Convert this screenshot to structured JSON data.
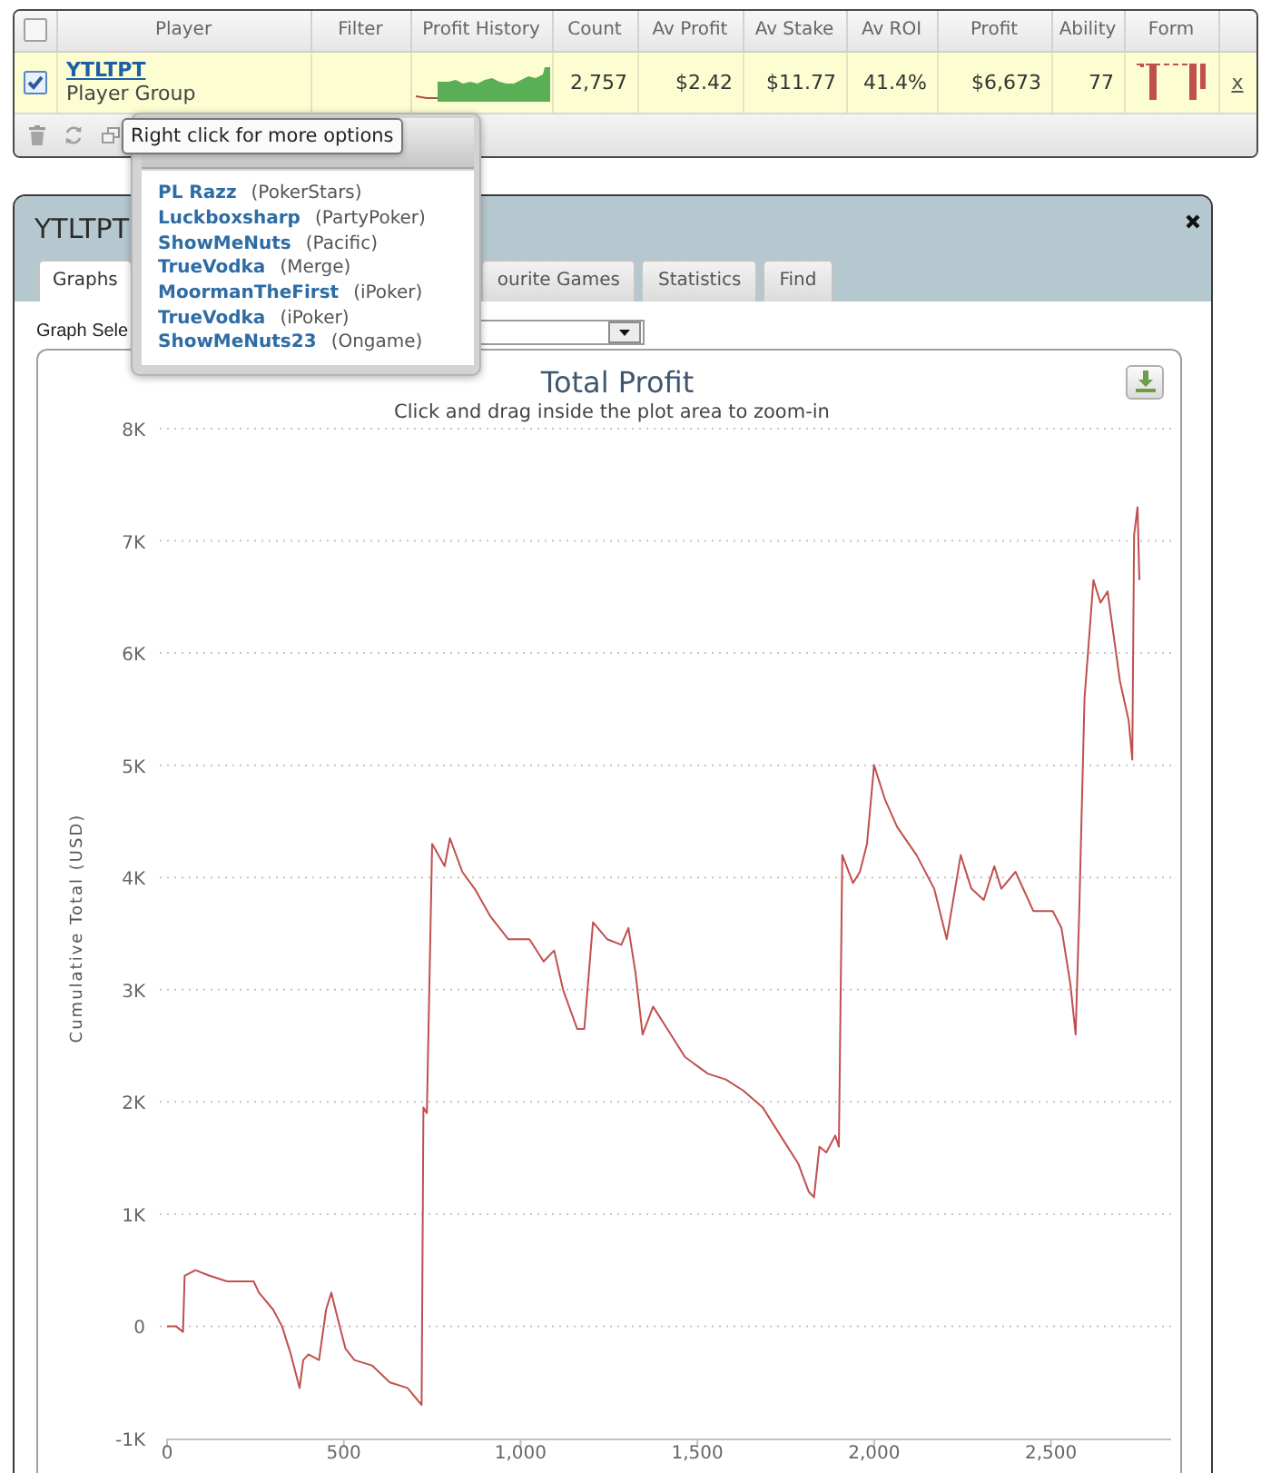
{
  "player_table": {
    "header_checked": false,
    "columns": [
      "Player",
      "Filter",
      "Profit History",
      "Count",
      "Av Profit",
      "Av Stake",
      "Av ROI",
      "Profit",
      "Ability",
      "Form"
    ],
    "rows": [
      {
        "checked": true,
        "player": "YTLTPT",
        "group": "Player Group",
        "count": "2,757",
        "av_profit": "$2.42",
        "av_stake": "$11.77",
        "av_roi": "41.4%",
        "profit": "$6,673",
        "ability": "77",
        "remove": "x"
      }
    ]
  },
  "tooltip": {
    "text": "Right click for more options"
  },
  "accounts_popup": {
    "items": [
      {
        "name": "PL Razz",
        "network": "(PokerStars)"
      },
      {
        "name": "Luckboxsharp",
        "network": "(PartyPoker)"
      },
      {
        "name": "ShowMeNuts",
        "network": "(Pacific)"
      },
      {
        "name": "TrueVodka",
        "network": "(Merge)"
      },
      {
        "name": "MoormanTheFirst",
        "network": "(iPoker)"
      },
      {
        "name": "TrueVodka",
        "network": "(iPoker)"
      },
      {
        "name": "ShowMeNuts23",
        "network": "(Ongame)"
      }
    ]
  },
  "window": {
    "title": "YTLTPT",
    "tabs": [
      {
        "label": "Graphs",
        "selected": true
      },
      {
        "label": "ourite Games",
        "selected": false
      },
      {
        "label": "Statistics",
        "selected": false
      },
      {
        "label": "Find",
        "selected": false
      }
    ],
    "graph_select": {
      "label": "Graph Sele"
    },
    "chart": {
      "subtitle": "Click and drag inside the plot area to zoom-in",
      "chart_data": {
        "type": "line",
        "title": "Total Profit",
        "ylabel": "Cumulative Total (USD)",
        "grid": true,
        "x": [
          0,
          25,
          45,
          50,
          80,
          120,
          170,
          245,
          260,
          300,
          325,
          350,
          375,
          385,
          400,
          430,
          450,
          465,
          480,
          505,
          530,
          580,
          630,
          680,
          720,
          725,
          735,
          750,
          785,
          800,
          835,
          870,
          915,
          965,
          1025,
          1065,
          1095,
          1120,
          1160,
          1180,
          1205,
          1245,
          1285,
          1305,
          1325,
          1345,
          1375,
          1415,
          1465,
          1530,
          1580,
          1630,
          1685,
          1735,
          1785,
          1815,
          1830,
          1845,
          1865,
          1890,
          1900,
          1910,
          1940,
          1960,
          1980,
          2000,
          2030,
          2065,
          2120,
          2170,
          2205,
          2245,
          2275,
          2310,
          2340,
          2360,
          2400,
          2450,
          2505,
          2530,
          2555,
          2570,
          2580,
          2595,
          2605,
          2620,
          2640,
          2660,
          2695,
          2720,
          2730,
          2735,
          2745,
          2750
        ],
        "series": [
          {
            "color": "#c0504d",
            "values": [
              0,
              0,
              -50,
              450,
              500,
              450,
              400,
              400,
              300,
              150,
              0,
              -250,
              -550,
              -300,
              -250,
              -300,
              150,
              300,
              100,
              -200,
              -300,
              -350,
              -500,
              -550,
              -700,
              1950,
              1900,
              4300,
              4100,
              4350,
              4050,
              3900,
              3650,
              3450,
              3450,
              3250,
              3350,
              3000,
              2650,
              2650,
              3600,
              3450,
              3400,
              3550,
              3150,
              2600,
              2850,
              2650,
              2400,
              2250,
              2200,
              2100,
              1950,
              1700,
              1450,
              1200,
              1150,
              1600,
              1550,
              1700,
              1600,
              4200,
              3950,
              4050,
              4300,
              5000,
              4700,
              4450,
              4200,
              3900,
              3450,
              4200,
              3900,
              3800,
              4100,
              3900,
              4050,
              3700,
              3700,
              3550,
              3050,
              2600,
              3700,
              5600,
              6000,
              6650,
              6450,
              6550,
              5750,
              5400,
              5050,
              7050,
              7300,
              6650
            ]
          }
        ],
        "xlim": [
          0,
          2840
        ],
        "ylim": [
          -1000,
          8000
        ],
        "xticks": [
          0,
          500,
          {
            "value": 1000,
            "label": "1,000"
          },
          {
            "value": 1500,
            "label": "1,500"
          },
          {
            "value": 2000,
            "label": "2,000"
          },
          {
            "value": 2500,
            "label": "2,500"
          }
        ],
        "yticks": [
          {
            "value": -1000,
            "label": "-1K"
          },
          0,
          {
            "value": 1000,
            "label": "1K"
          },
          {
            "value": 2000,
            "label": "2K"
          },
          {
            "value": 3000,
            "label": "3K"
          },
          {
            "value": 4000,
            "label": "4K"
          },
          {
            "value": 5000,
            "label": "5K"
          },
          {
            "value": 6000,
            "label": "6K"
          },
          {
            "value": 7000,
            "label": "7K"
          },
          {
            "value": 8000,
            "label": "8K"
          }
        ]
      }
    }
  }
}
